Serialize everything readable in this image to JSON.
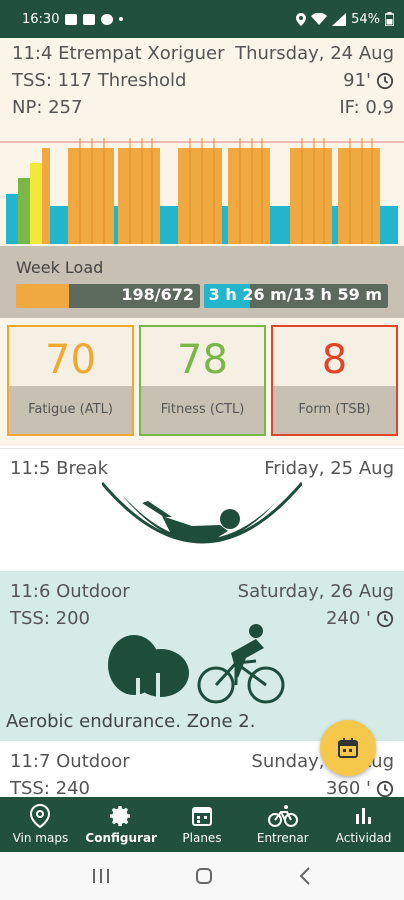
{
  "status_bar": {
    "time": "16:30",
    "battery": "54%"
  },
  "summary_card": {
    "title": "11:4 Etrempat Xoriguer",
    "date": "Thursday, 24 Aug",
    "tss": "TSS: 117 Threshold",
    "duration": "91'",
    "np": "NP: 257",
    "if": "IF: 0,9",
    "week_load_label": "Week Load",
    "load_text": "198/672",
    "load_fraction": 0.29,
    "time_text": "3 h 26 m/13 h 59 m",
    "time_fraction": 0.25,
    "metrics": [
      {
        "value": "70",
        "label": "Fatigue (ATL)",
        "color": "#f0a830"
      },
      {
        "value": "78",
        "label": "Fitness (CTL)",
        "color": "#7ab648"
      },
      {
        "value": "8",
        "label": "Form (TSB)",
        "color": "#e0452a"
      }
    ]
  },
  "days": [
    {
      "title": "11:5 Break",
      "date": "Friday, 25 Aug",
      "illustration": "hammock-illustration"
    },
    {
      "title": "11:6 Outdoor",
      "date": "Saturday, 26 Aug",
      "tss": "TSS: 200",
      "duration": "240 '",
      "illustration": "cyclist-trees-illustration",
      "caption": "Aerobic endurance. Zone 2."
    },
    {
      "title": "11:7 Outdoor",
      "date": "Sunday, 27 Aug",
      "tss": "TSS: 240",
      "duration": "360 '"
    }
  ],
  "nav": [
    {
      "label": "Vin maps",
      "icon": "map-pin-icon"
    },
    {
      "label": "Configurar",
      "icon": "gear-icon",
      "active": true
    },
    {
      "label": "Planes",
      "icon": "calendar-icon"
    },
    {
      "label": "Entrenar",
      "icon": "bicycle-icon"
    },
    {
      "label": "Actividad",
      "icon": "bar-chart-icon"
    }
  ],
  "colors": {
    "header": "#21513e",
    "orange": "#f0a840",
    "cyan": "#22b5cc",
    "green_bar": "#7ab648",
    "yellow_bar": "#f2e83a",
    "teal_card": "#d4ebe6",
    "fab": "#f5c84b"
  }
}
